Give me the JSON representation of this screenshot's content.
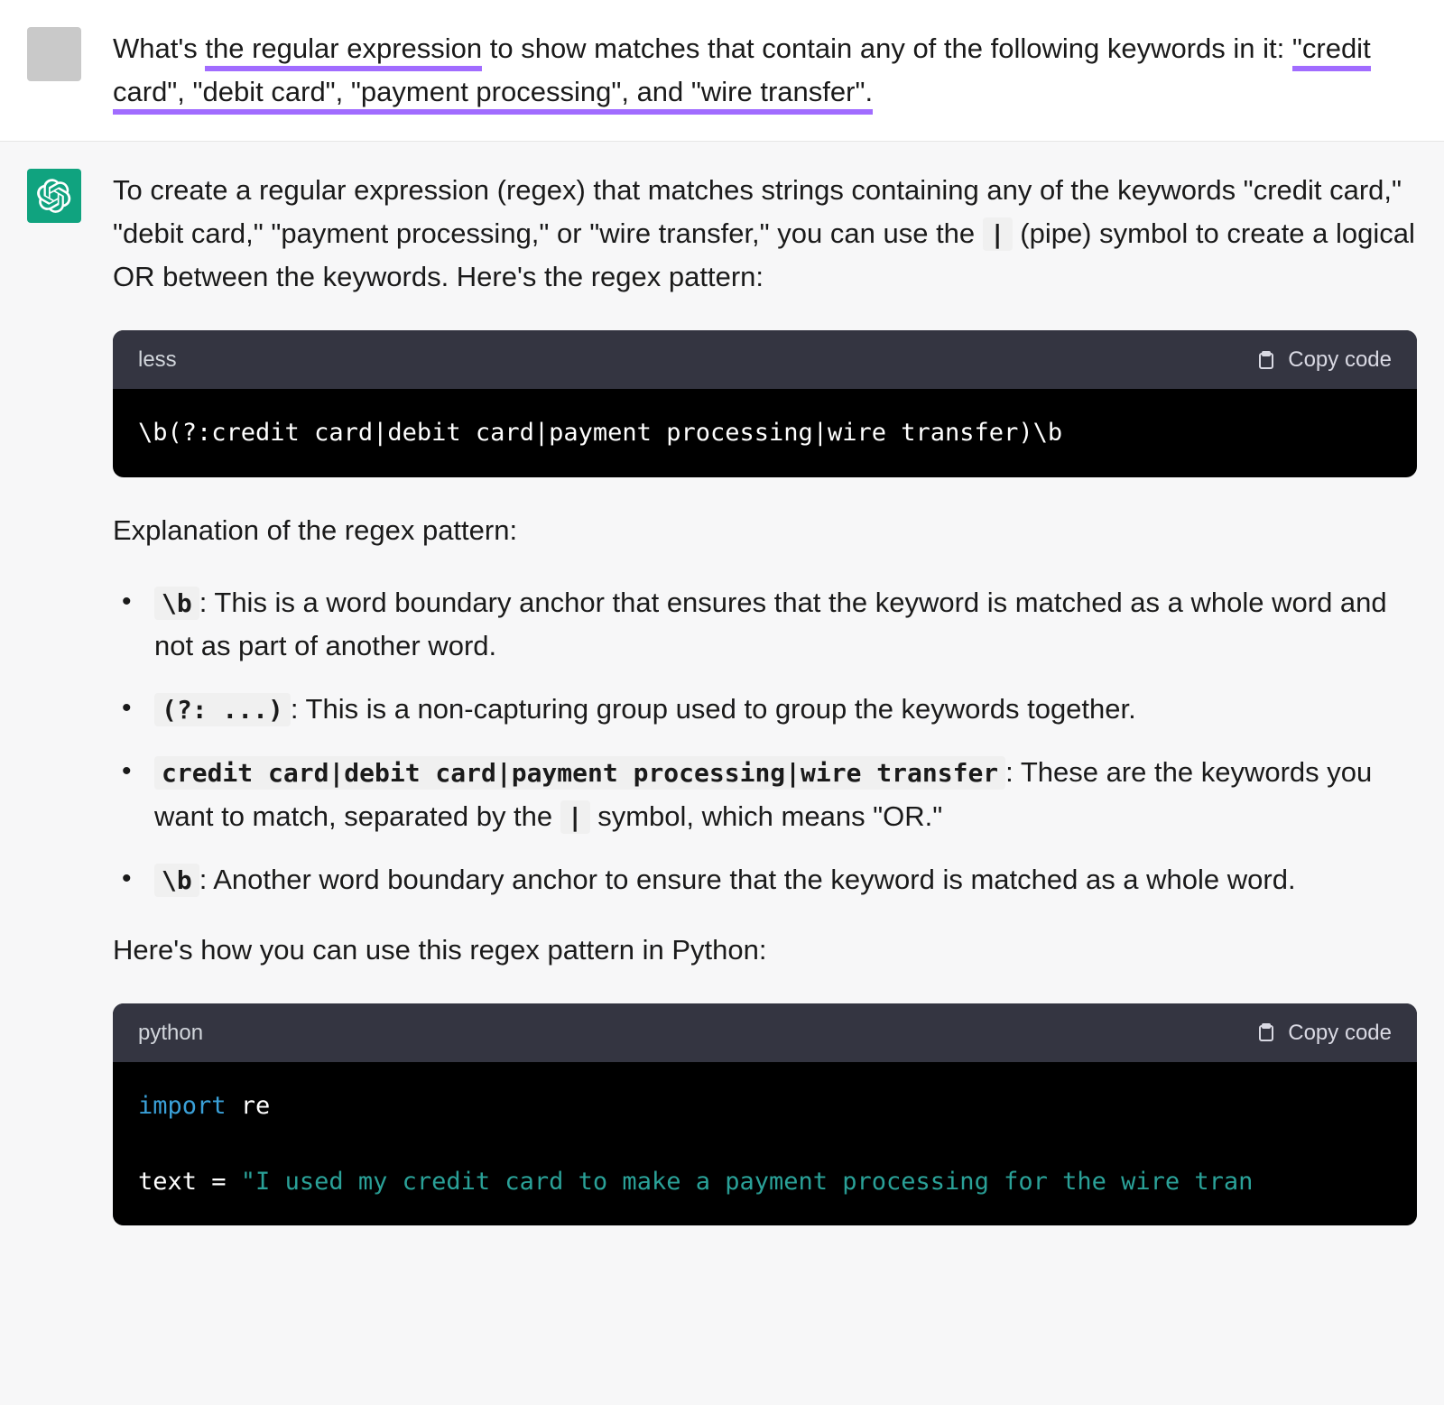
{
  "user": {
    "msg_pre": "What's ",
    "msg_u1": "the regular expression",
    "msg_mid": " to show matches that contain any of the following keywords in it: ",
    "msg_u2": "\"credit card\", \"debit card\", \"payment processing\", and \"wire transfer\".",
    "msg_post": ""
  },
  "assistant": {
    "p1_a": "To create a regular expression (regex) that matches strings containing any of the keywords \"credit card,\" \"debit card,\" \"payment processing,\" or \"wire transfer,\" you can use the ",
    "p1_code": "|",
    "p1_b": " (pipe) symbol to create a logical OR between the keywords. Here's the regex pattern:",
    "block1": {
      "lang": "less",
      "copy": "Copy code",
      "code": "\\b(?:credit card|debit card|payment processing|wire transfer)\\b"
    },
    "p2": "Explanation of the regex pattern:",
    "bullets": [
      {
        "code": "\\b",
        "text": ": This is a word boundary anchor that ensures that the keyword is matched as a whole word and not as part of another word."
      },
      {
        "code": "(?: ...)",
        "text": ": This is a non-capturing group used to group the keywords together."
      },
      {
        "code": "credit card|debit card|payment processing|wire transfer",
        "text_a": ": These are the keywords you want to match, separated by the ",
        "inner_code": "|",
        "text_b": " symbol, which means \"OR.\""
      },
      {
        "code": "\\b",
        "text": ": Another word boundary anchor to ensure that the keyword is matched as a whole word."
      }
    ],
    "p3": "Here's how you can use this regex pattern in Python:",
    "block2": {
      "lang": "python",
      "copy": "Copy code",
      "line1_kw": "import",
      "line1_rest": " re",
      "line2_a": "text = ",
      "line2_str": "\"I used my credit card to make a payment processing for the wire tran"
    }
  }
}
